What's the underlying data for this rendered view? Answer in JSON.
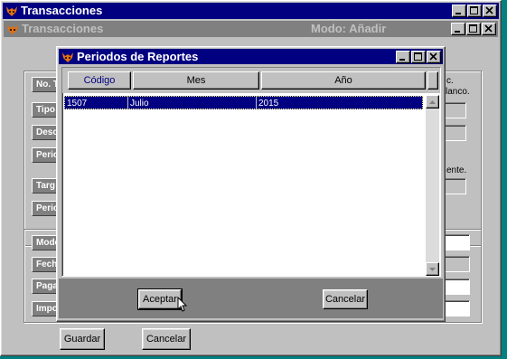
{
  "main_window": {
    "title": "Transacciones",
    "inner_title": "Transacciones",
    "mode_text": "Modo: Añadir",
    "labels": [
      "No. T",
      "Tipo",
      "Desc",
      "Perio",
      "Targ",
      "Perio",
      "Mode",
      "Fech",
      "Paga",
      "Impo"
    ],
    "side_text": {
      "blank": "lanco.",
      "partial": "ente.",
      "c_dot": "c."
    },
    "buttons": {
      "save": "Guardar",
      "cancel": "Cancelar"
    }
  },
  "dialog": {
    "title": "Periodos de Reportes",
    "columns": [
      "Código",
      "Mes",
      "Año"
    ],
    "rows": [
      {
        "codigo": "1507",
        "mes": "Julio",
        "anio": "2015",
        "selected": true
      }
    ],
    "buttons": {
      "accept": "Aceptar",
      "cancel": "Cancelar"
    }
  },
  "colors": {
    "desktop": "#008080",
    "title_active": "#000080",
    "title_inactive": "#808080",
    "face": "#c0c0c0",
    "selection": "#000080",
    "code_header_text": "#000080"
  },
  "icons": [
    "app-fox-icon",
    "minimize-icon",
    "maximize-icon",
    "close-icon",
    "scroll-up-icon",
    "scroll-down-icon",
    "mouse-cursor-icon"
  ]
}
